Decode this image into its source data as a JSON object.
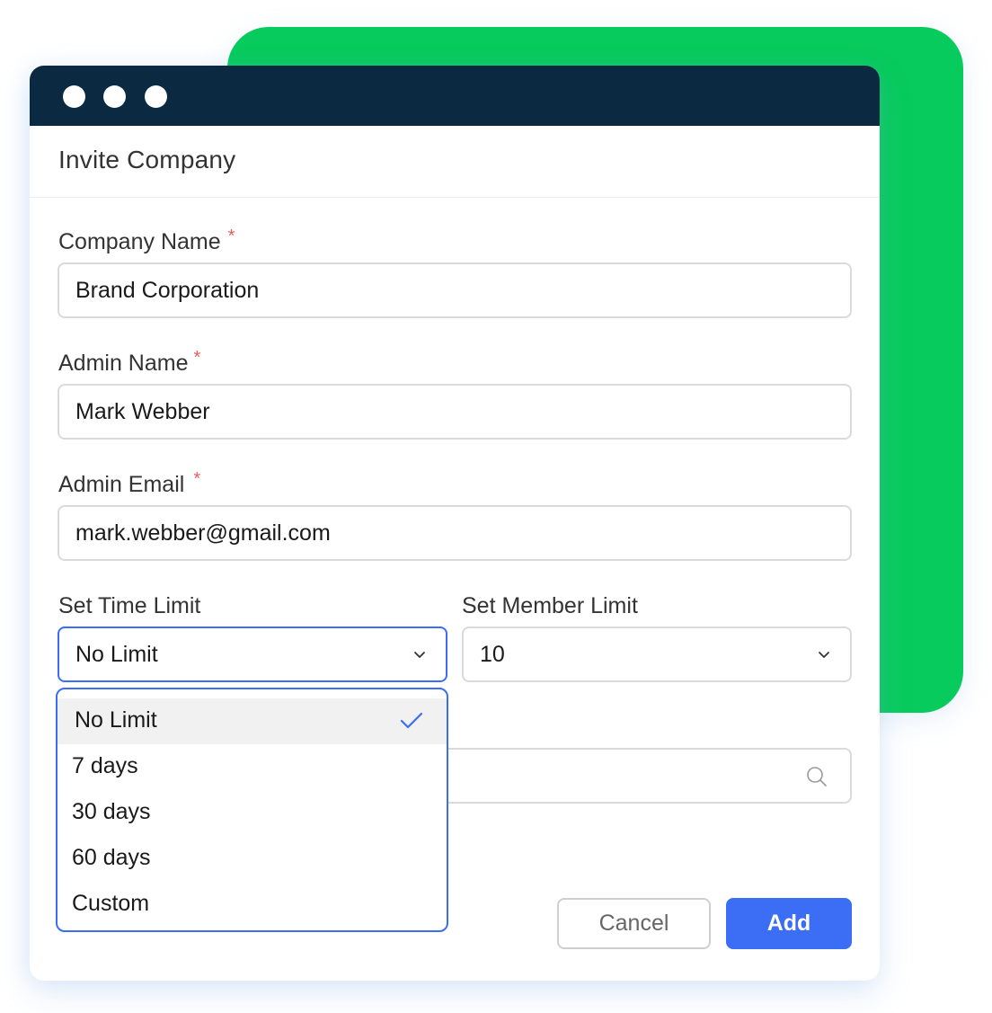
{
  "colors": {
    "accent": "#3b6ef5",
    "titlebar": "#0b2a42",
    "backdrop_card": "#07cb5c",
    "required": "#f05a5a"
  },
  "window": {
    "controls": [
      "dot",
      "dot",
      "dot"
    ]
  },
  "dialog": {
    "title": "Invite Company",
    "fields": {
      "company_name": {
        "label": "Company Name",
        "required_mark": "*",
        "value": "Brand Corporation"
      },
      "admin_name": {
        "label": "Admin Name",
        "required_mark": "*",
        "value": "Mark Webber"
      },
      "admin_email": {
        "label": "Admin Email",
        "required_mark": "*",
        "value": "mark.webber@gmail.com"
      },
      "time_limit": {
        "label": "Set Time Limit",
        "value": "No Limit"
      },
      "member_limit": {
        "label": "Set Member Limit",
        "value": "10"
      }
    },
    "time_limit_options": [
      {
        "label": "No Limit",
        "selected": true
      },
      {
        "label": "7 days",
        "selected": false
      },
      {
        "label": "30 days",
        "selected": false
      },
      {
        "label": "60 days",
        "selected": false
      },
      {
        "label": "Custom",
        "selected": false
      }
    ],
    "search_icon": "search-icon",
    "buttons": {
      "cancel": "Cancel",
      "add": "Add"
    }
  }
}
